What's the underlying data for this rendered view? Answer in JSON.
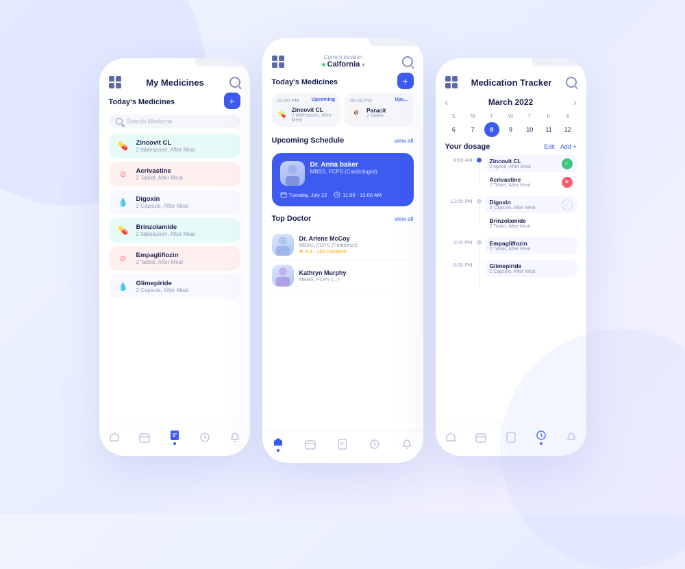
{
  "phone1": {
    "title": "My Medicines",
    "section": "Today's Medicines",
    "search_placeholder": "Search Medicine",
    "medicines": [
      {
        "name": "Zincovit CL",
        "dose": "2 tablespoon, After Meal",
        "color": "cyan",
        "icon": "💊"
      },
      {
        "name": "Acrivastine",
        "dose": "2 Tablet, After Meal",
        "color": "pink",
        "icon": "🚫"
      },
      {
        "name": "Digoxin",
        "dose": "2 Capsule, After Meal",
        "color": "default",
        "icon": "💧"
      },
      {
        "name": "Brinzolamide",
        "dose": "2 tablespoon, After Meal",
        "color": "cyan",
        "icon": "💊"
      },
      {
        "name": "Empagliflozin",
        "dose": "2 Tablet, After Meal",
        "color": "pink",
        "icon": "🚫"
      },
      {
        "name": "Glimepiride",
        "dose": "2 Capsule, After Meal",
        "color": "default",
        "icon": "💧"
      }
    ]
  },
  "phone2": {
    "location_label": "Current location",
    "location_name": "Calfornia",
    "section": "Today's Medicines",
    "times": [
      {
        "time": "02:00 PM",
        "status": "Upcoming",
        "med_name": "Zincovit CL",
        "med_dose": "2 tablespoon, After Meal",
        "color": "cyan"
      },
      {
        "time": "02:00 PM",
        "status": "Upc...",
        "med_name": "Paracit",
        "med_dose": "2 Tablet",
        "color": "pink"
      }
    ],
    "upcoming_label": "Upcoming Schedule",
    "view_all": "view all",
    "doctor_card": {
      "name": "Dr. Anna baker",
      "spec": "MBBS, FCPS (Cardiologist)",
      "date": "Tuesday, July 22",
      "time": "11:00 - 12:00 AM"
    },
    "top_doctor_label": "Top Doctor",
    "doctors": [
      {
        "name": "Dr. Arlene McCoy",
        "spec": "MBBS, FCPS (Pediatrics)",
        "rating": "4.6",
        "reviews": "150 Reviews"
      },
      {
        "name": "Kathryn Murphy",
        "spec": "MBBS, FCPS (...)"
      }
    ]
  },
  "phone3": {
    "title": "Medication Tracker",
    "calendar": {
      "month": "March 2022",
      "day_labels": [
        "S",
        "M",
        "T",
        "W",
        "T",
        "F",
        "S"
      ],
      "days": [
        "6",
        "7",
        "8",
        "9",
        "10",
        "11",
        "12"
      ],
      "today": "8"
    },
    "dosage_section": "Your dosage",
    "edit_label": "Edit",
    "add_label": "Add +",
    "time_groups": [
      {
        "time": "8:00 AM",
        "items": [
          {
            "name": "Zincovit CL",
            "dose": "2 spoon, After Meal",
            "status": "green"
          },
          {
            "name": "Acrivastine",
            "dose": "2 Tablet, After Meal",
            "status": "red"
          }
        ]
      },
      {
        "time": "12:00 PM",
        "items": [
          {
            "name": "Digoxin",
            "dose": "2 Capsule, After Meal",
            "status": "outline"
          },
          {
            "name": "Brinzolamide",
            "dose": "2 Tablet, After Meal",
            "status": "none"
          }
        ]
      },
      {
        "time": "3:00 PM",
        "items": [
          {
            "name": "Empagliflozin",
            "dose": "2 Tablet, After Meal",
            "status": "none"
          }
        ]
      },
      {
        "time": "8:00 PM",
        "items": [
          {
            "name": "Glimepiride",
            "dose": "2 Capsule, After Meal",
            "status": "none"
          }
        ]
      }
    ]
  },
  "colors": {
    "accent": "#3d5af1",
    "green": "#3dc47e",
    "red": "#ff5c72",
    "text_dark": "#1a1f4e",
    "text_light": "#9099bb"
  }
}
